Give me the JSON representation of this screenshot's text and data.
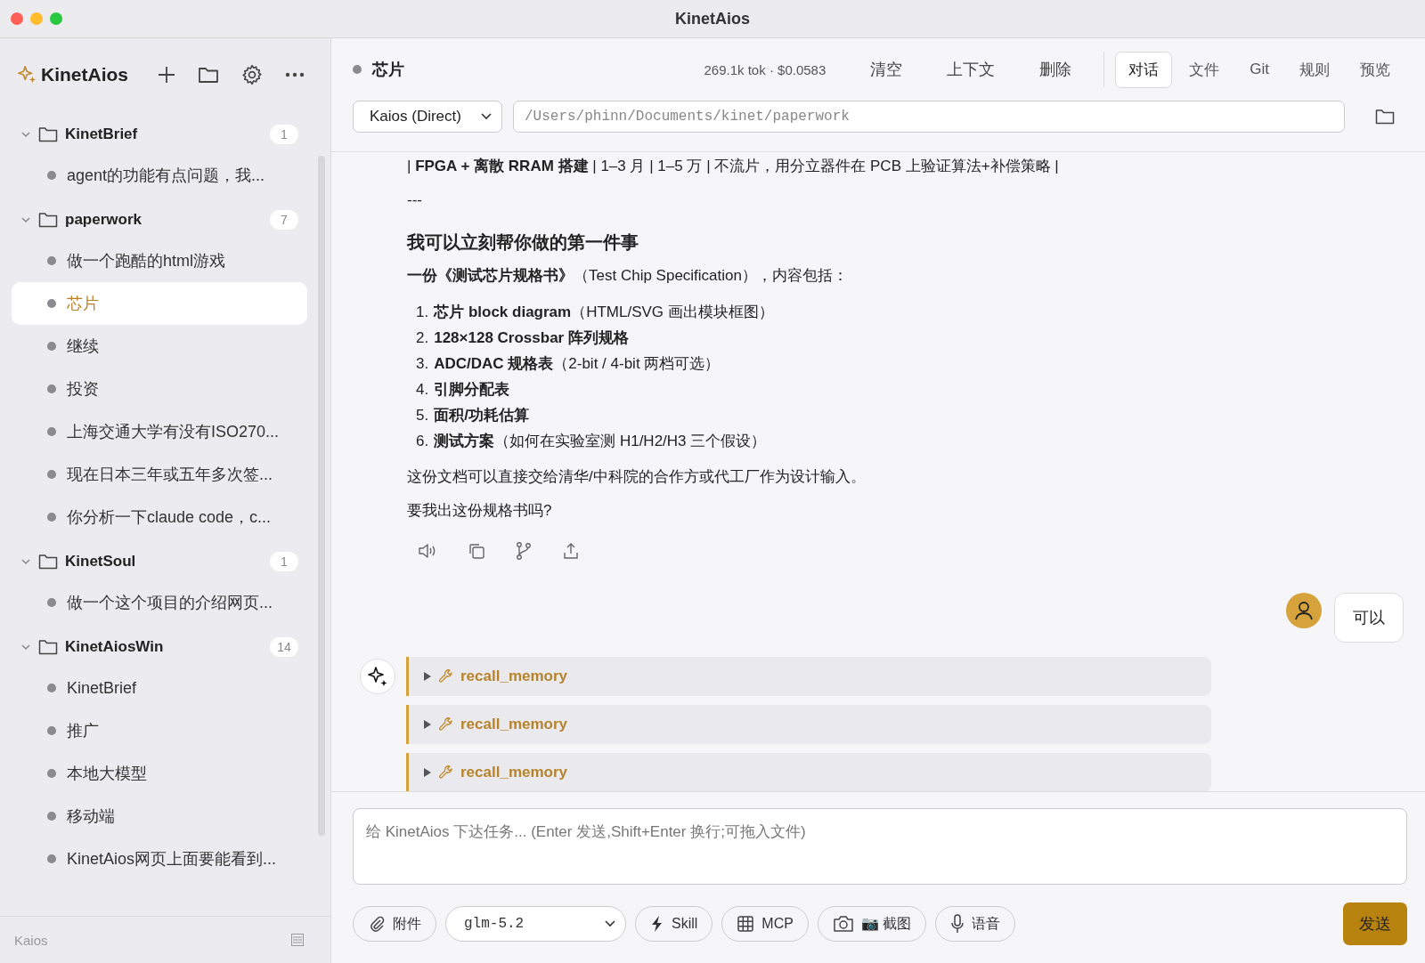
{
  "window": {
    "title": "KinetAios"
  },
  "sidebar": {
    "brand": "KinetAios",
    "folders": [
      {
        "name": "KinetBrief",
        "count": "1",
        "expanded": true,
        "children": [
          {
            "title": "agent的功能有点问题，我...",
            "selected": false
          }
        ]
      },
      {
        "name": "paperwork",
        "count": "7",
        "expanded": true,
        "children": [
          {
            "title": "做一个跑酷的html游戏",
            "selected": false
          },
          {
            "title": "芯片",
            "selected": true
          },
          {
            "title": "继续",
            "selected": false
          },
          {
            "title": "投资",
            "selected": false
          },
          {
            "title": "上海交通大学有没有ISO270...",
            "selected": false
          },
          {
            "title": "现在日本三年或五年多次签...",
            "selected": false
          },
          {
            "title": "你分析一下claude code，c...",
            "selected": false
          }
        ]
      },
      {
        "name": "KinetSoul",
        "count": "1",
        "expanded": true,
        "children": [
          {
            "title": "做一个这个项目的介绍网页...",
            "selected": false
          }
        ]
      },
      {
        "name": "KinetAiosWin",
        "count": "14",
        "expanded": true,
        "children": [
          {
            "title": "KinetBrief",
            "selected": false
          },
          {
            "title": "推广",
            "selected": false
          },
          {
            "title": "本地大模型",
            "selected": false
          },
          {
            "title": "移动端",
            "selected": false
          },
          {
            "title": "KinetAios网页上面要能看到...",
            "selected": false
          }
        ]
      }
    ],
    "footer": "Kaios"
  },
  "header": {
    "title": "芯片",
    "stats": "269.1k tok · $0.0583",
    "actions": [
      "清空",
      "上下文",
      "删除"
    ],
    "tabs": [
      {
        "label": "对话",
        "selected": true
      },
      {
        "label": "文件",
        "selected": false
      },
      {
        "label": "Git",
        "selected": false
      },
      {
        "label": "规则",
        "selected": false
      },
      {
        "label": "预览",
        "selected": false
      }
    ],
    "agent": "Kaios (Direct)",
    "path": "/Users/phinn/Documents/kinet/paperwork"
  },
  "messages": [
    {
      "kind": "assistant",
      "blocks": [
        {
          "kind": "paragraph",
          "text": "| **FPGA + 离散 RRAM 搭建** | 1–3 月 | 1–5 万 | 不流片，用分立器件在 PCB 上验证算法+补偿策略 |"
        },
        {
          "kind": "paragraph",
          "text": "---"
        },
        {
          "kind": "heading",
          "text": "我可以立刻帮你做的第一件事"
        },
        {
          "kind": "paragraph",
          "text": "**一份《测试芯片规格书》**（Test Chip Specification），内容包括："
        },
        {
          "kind": "list",
          "items": [
            {
              "number": "1.",
              "text": "**芯片 block diagram**（HTML/SVG 画出模块框图）"
            },
            {
              "number": "2.",
              "text": "**128×128 Crossbar 阵列规格**"
            },
            {
              "number": "3.",
              "text": "**ADC/DAC 规格表**（2-bit / 4-bit 两档可选）"
            },
            {
              "number": "4.",
              "text": "**引脚分配表**"
            },
            {
              "number": "5.",
              "text": "**面积/功耗估算**"
            },
            {
              "number": "6.",
              "text": "**测试方案**（如何在实验室测 H1/H2/H3 三个假设）"
            }
          ]
        },
        {
          "kind": "paragraph",
          "text": "这份文档可以直接交给清华/中科院的合作方或代工厂作为设计输入。"
        },
        {
          "kind": "paragraph",
          "text": "要我出这份规格书吗?"
        }
      ]
    },
    {
      "kind": "user",
      "text": "可以"
    },
    {
      "kind": "tools",
      "calls": [
        {
          "name": "recall_memory",
          "expanded": false
        },
        {
          "name": "recall_memory",
          "expanded": false
        },
        {
          "name": "recall_memory",
          "expanded": false
        }
      ]
    }
  ],
  "composer": {
    "placeholder": "给 KinetAios 下达任务... (Enter 发送,Shift+Enter 换行;可拖入文件)",
    "buttons": [
      {
        "kind": "attach",
        "label": "附件"
      },
      {
        "kind": "model",
        "label": "glm-5.2"
      },
      {
        "kind": "skill",
        "label": "Skill"
      },
      {
        "kind": "mcp",
        "label": "MCP"
      },
      {
        "kind": "screenshot",
        "label": "📷 截图"
      },
      {
        "kind": "voice",
        "label": "语音"
      }
    ],
    "send": "发送"
  }
}
